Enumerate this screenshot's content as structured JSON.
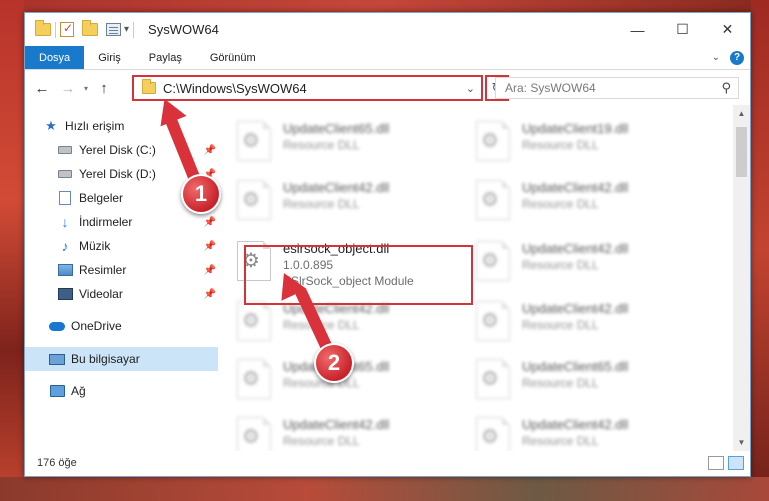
{
  "window": {
    "title": "SysWOW64",
    "controls": {
      "minimize": "—",
      "maximize": "☐",
      "close": "✕"
    }
  },
  "ribbon": {
    "tabs": [
      "Dosya",
      "Giriş",
      "Paylaş",
      "Görünüm"
    ],
    "active_tab": "Dosya",
    "help": "?"
  },
  "navigation": {
    "address": "C:\\Windows\\SysWOW64",
    "search_placeholder": "Ara: SysWOW64"
  },
  "sidebar": {
    "items": [
      {
        "label": "Hızlı erişim",
        "icon": "star-icon",
        "pinned": false
      },
      {
        "label": "Yerel Disk (C:)",
        "icon": "disk-icon",
        "pinned": true
      },
      {
        "label": "Yerel Disk (D:)",
        "icon": "disk-icon",
        "pinned": true
      },
      {
        "label": "Belgeler",
        "icon": "documents-icon",
        "pinned": true
      },
      {
        "label": "İndirmeler",
        "icon": "downloads-icon",
        "pinned": true
      },
      {
        "label": "Müzik",
        "icon": "music-icon",
        "pinned": true
      },
      {
        "label": "Resimler",
        "icon": "pictures-icon",
        "pinned": true
      },
      {
        "label": "Videolar",
        "icon": "videos-icon",
        "pinned": true
      },
      {
        "label": "OneDrive",
        "icon": "onedrive-icon",
        "pinned": false
      },
      {
        "label": "Bu bilgisayar",
        "icon": "this-pc-icon",
        "pinned": false,
        "selected": true
      },
      {
        "label": "Ağ",
        "icon": "network-icon",
        "pinned": false
      }
    ]
  },
  "files": [
    {
      "name": "UpdateClient65.dll",
      "meta": "Resource DLL"
    },
    {
      "name": "UpdateClient19.dll",
      "meta": "Resource DLL"
    },
    {
      "name": "UpdateClient42.dll",
      "meta": "Resource DLL"
    },
    {
      "name": "UpdateClient42.dll",
      "meta": "Resource DLL"
    },
    {
      "name": "esirsock_object.dll",
      "version": "1.0.0.895",
      "description": "ESlrSock_object Module",
      "highlighted": true
    },
    {
      "name": "UpdateClient42.dll",
      "meta": "Resource DLL"
    },
    {
      "name": "UpdateClient42.dll",
      "meta": "Resource DLL"
    },
    {
      "name": "UpdateClient42.dll",
      "meta": "Resource DLL"
    },
    {
      "name": "UpdateClient65.dll",
      "meta": "Resource DLL"
    },
    {
      "name": "UpdateClient65.dll",
      "meta": "Resource DLL"
    },
    {
      "name": "UpdateClient42.dll",
      "meta": "Resource DLL"
    },
    {
      "name": "UpdateClient42.dll",
      "meta": "Resource DLL"
    }
  ],
  "status": {
    "item_count": "176 öğe"
  },
  "annotations": {
    "step1": "1",
    "step2": "2"
  },
  "colors": {
    "accent": "#1979ca",
    "highlight": "#d3343a",
    "selection": "#cce4f7"
  }
}
